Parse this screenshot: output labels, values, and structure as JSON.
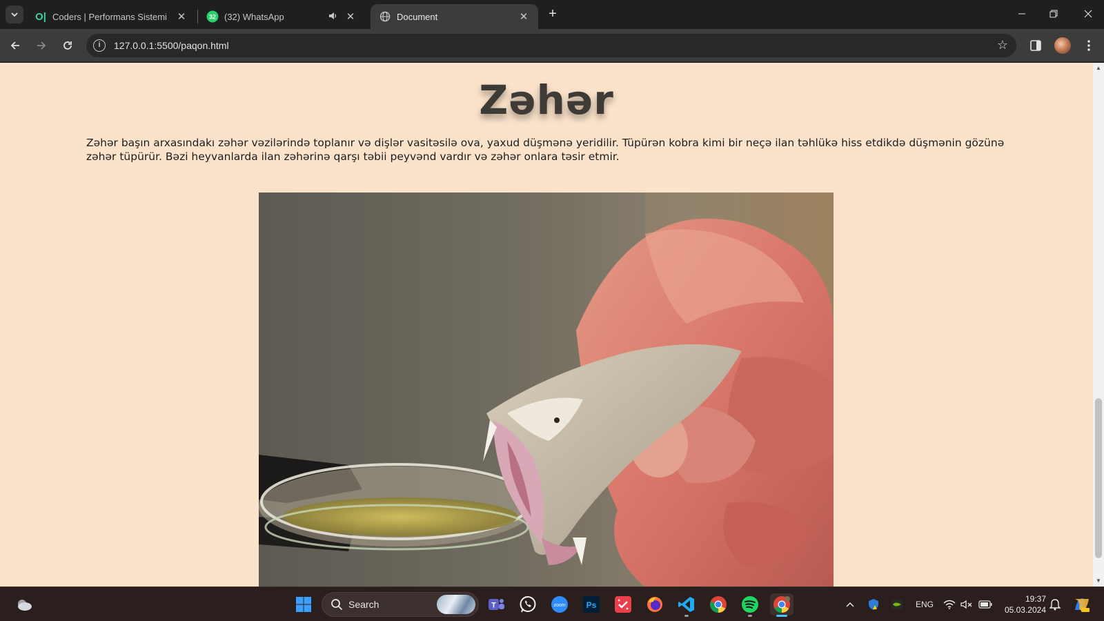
{
  "browser": {
    "tabs": [
      {
        "title": "Coders | Performans Sistemi",
        "favicon": "coders-logo-icon",
        "active": false
      },
      {
        "title": "(32) WhatsApp",
        "favicon": "whatsapp-icon",
        "badge": "32",
        "audio": true,
        "active": false
      },
      {
        "title": "Document",
        "favicon": "globe-icon",
        "active": true
      }
    ],
    "address": "127.0.0.1:5500/paqon.html"
  },
  "page": {
    "heading": "Zəhər",
    "paragraph": "Zəhər başın arxasındakı zəhər vəzilərində toplanır və dişlər vasitəsilə ova, yaxud düşmənə yeridilir. Tüpürən kobra kimi bir neçə ilan təhlükə hiss etdikdə düşmənin gözünə zəhər tüpürür. Bəzi heyvanlarda ilan zəhərinə qarşı təbii peyvənd vardır və zəhər onlara təsir etmir.",
    "image_subject": "snake-venom-extraction-photo",
    "background_color": "#fbe3cb"
  },
  "taskbar": {
    "search_label": "Search",
    "apps": [
      "windows-start-icon",
      "teams-icon",
      "whatsapp-icon",
      "zoom-icon",
      "photoshop-icon",
      "calendar-app-icon",
      "firefox-icon",
      "vscode-icon",
      "chrome-icon",
      "spotify-icon",
      "chrome-profile-icon"
    ],
    "zoom_label": "zoom",
    "ps_label": "Ps",
    "language": "ENG",
    "time": "19:37",
    "date": "05.03.2024"
  }
}
